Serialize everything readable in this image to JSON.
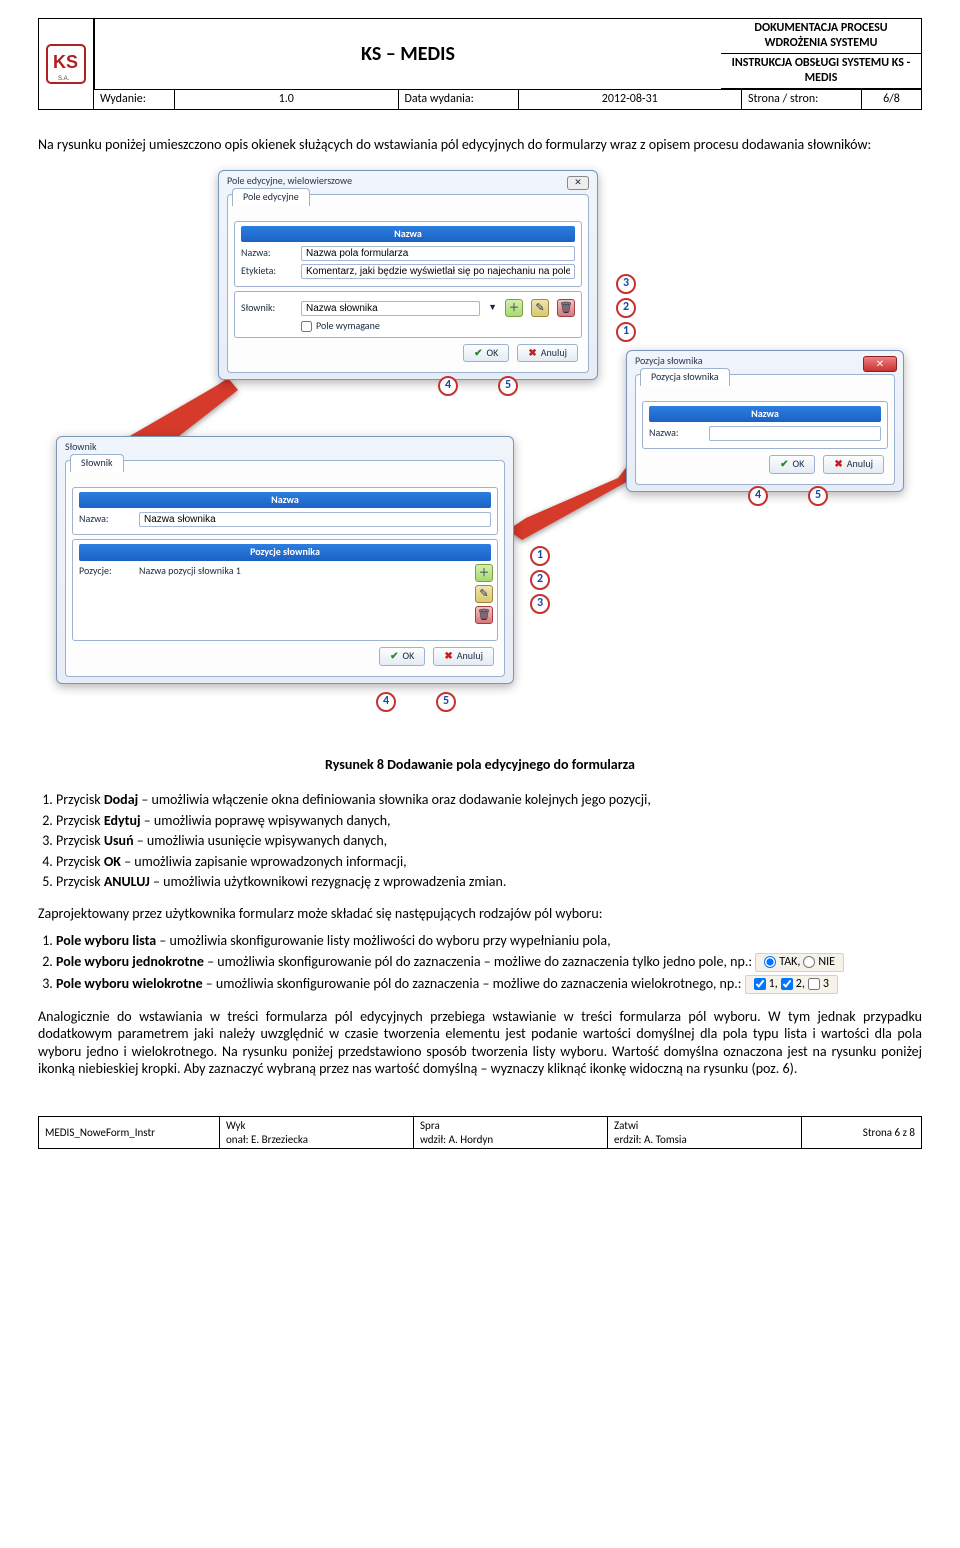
{
  "header": {
    "doc_line1": "DOKUMENTACJA PROCESU WDROŻENIA SYSTEMU",
    "doc_line2": "INSTRUKCJA OBSŁUGI SYSTEMU KS - MEDIS",
    "brand": "KS – MEDIS",
    "wydanie_lbl": "Wydanie:",
    "wydanie_val": "1.0",
    "data_lbl": "Data wydania:",
    "data_val": "2012-08-31",
    "strona_lbl": "Strona / stron:",
    "strona_val": "6/8"
  },
  "intro": "Na rysunku poniżej umieszczono opis okienek służących do wstawiania pól edycyjnych do formularzy wraz z opisem procesu dodawania słowników:",
  "win1": {
    "title": "Pole edycyjne, wielowierszowe",
    "tab": "Pole edycyjne",
    "grp_nazwa": "Nazwa",
    "lbl_nazwa": "Nazwa:",
    "val_nazwa": "Nazwa pola formularza",
    "lbl_etykieta": "Etykieta:",
    "val_etykieta": "Komentarz, jaki będzie wyświetlał się po najechaniu na pole",
    "lbl_slownik": "Słownik:",
    "val_slownik": "Nazwa słownika",
    "chk": "Pole wymagane",
    "ok": "OK",
    "anuluj": "Anuluj"
  },
  "win2": {
    "title": "Słownik",
    "tab": "Słownik",
    "grp_nazwa": "Nazwa",
    "lbl_nazwa": "Nazwa:",
    "val_nazwa": "Nazwa słownika",
    "grp_poz": "Pozycje słownika",
    "lbl_poz": "Pozycje:",
    "val_poz": "Nazwa pozycji słownika 1",
    "ok": "OK",
    "anuluj": "Anuluj"
  },
  "win3": {
    "title": "Pozycja słownika",
    "tab": "Pozycja słownika",
    "grp": "Nazwa",
    "lbl": "Nazwa:",
    "ok": "OK",
    "anuluj": "Anuluj"
  },
  "icons": {
    "add": "＋",
    "edit": "✎",
    "del": "🗑"
  },
  "caption": "Rysunek 8 Dodawanie pola edycyjnego do formularza",
  "list1": {
    "i1a": "Przycisk ",
    "i1b": "Dodaj",
    "i1c": " – umożliwia włączenie okna definiowania słownika oraz dodawanie kolejnych jego pozycji,",
    "i2a": "Przycisk ",
    "i2b": "Edytuj",
    "i2c": " – umożliwia poprawę wpisywanych danych,",
    "i3a": "Przycisk ",
    "i3b": "Usuń",
    "i3c": " – umożliwia usunięcie wpisywanych danych,",
    "i4a": "Przycisk ",
    "i4b": "OK",
    "i4c": " – umożliwia zapisanie wprowadzonych informacji,",
    "i5a": "Przycisk ",
    "i5b": "ANULUJ",
    "i5c": " – umożliwia użytkownikowi rezygnację z wprowadzenia zmian."
  },
  "para2": "Zaprojektowany przez użytkownika formularz może składać się następujących rodzajów pól wyboru:",
  "list2": {
    "i1b": "Pole wyboru lista",
    "i1c": " – umożliwia skonfigurowanie listy możliwości do wyboru przy wypełnianiu pola,",
    "i2b": "Pole wyboru jednokrotne",
    "i2c": " – umożliwia skonfigurowanie pól do zaznaczenia – możliwe do zaznaczenia tylko jedno pole, np.:",
    "i3b": "Pole wyboru wielokrotne",
    "i3c": " – umożliwia skonfigurowanie pól do zaznaczenia – możliwe do zaznaczenia wielokrotnego, np.:"
  },
  "radio": {
    "tak": "TAK,",
    "nie": "NIE"
  },
  "checks": {
    "c1": "1,",
    "c2": "2,",
    "c3": "3"
  },
  "para3": "Analogicznie do wstawiania w treści formularza pól edycyjnych przebiega wstawianie w treści formularza pól wyboru. W tym jednak przypadku dodatkowym parametrem jaki należy uwzględnić w czasie tworzenia elementu jest podanie wartości domyślnej dla pola typu lista i wartości dla pola wyboru jedno i wielokrotnego. Na rysunku poniżej przedstawiono sposób tworzenia listy wyboru. Wartość domyślna oznaczona jest na rysunku poniżej ikonką niebieskiej kropki. Aby zaznaczyć wybraną przez nas wartość domyślną – wyznaczy kliknąć ikonkę widoczną na rysunku (poz. 6).",
  "footer": {
    "id": "MEDIS_NoweForm_Instr",
    "wyk_l": "Wyk",
    "wyk_v": "onał: E. Brzeziecka",
    "spr_l": "Spra",
    "spr_v": "wdził: A. Hordyn",
    "zat_l": "Zatwi",
    "zat_v": "erdził: A. Tomsia",
    "pg": "Strona 6 z 8"
  }
}
